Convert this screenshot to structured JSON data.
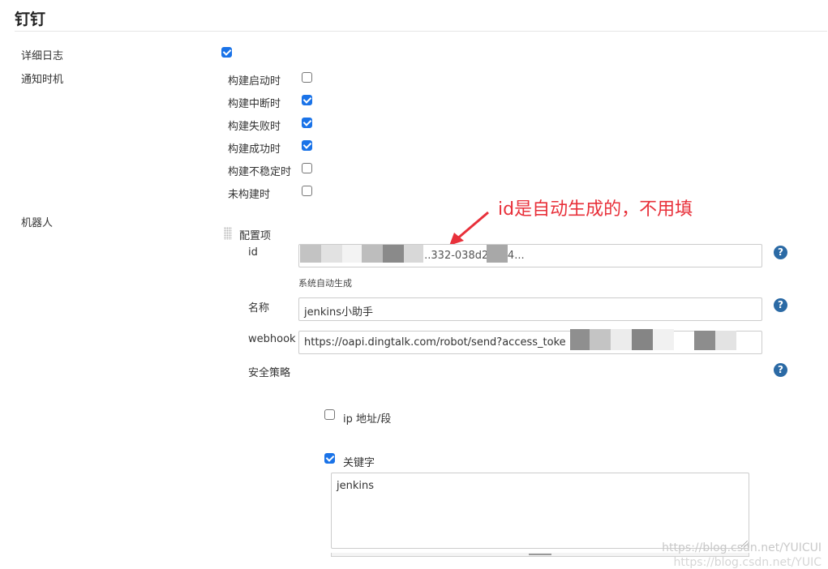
{
  "section": {
    "title": "钉钉"
  },
  "fields": {
    "verbose_log": {
      "label": "详细日志",
      "checked": true
    },
    "notify_timing": {
      "label": "通知时机",
      "options": [
        {
          "label": "构建启动时",
          "checked": false
        },
        {
          "label": "构建中断时",
          "checked": true
        },
        {
          "label": "构建失败时",
          "checked": true
        },
        {
          "label": "构建成功时",
          "checked": true
        },
        {
          "label": "构建不稳定时",
          "checked": false
        },
        {
          "label": "未构建时",
          "checked": false
        }
      ]
    },
    "robot": {
      "label": "机器人",
      "config_label": "配置项",
      "id": {
        "label": "id",
        "value": "...332-038d243c4...",
        "hint": "系统自动生成"
      },
      "name": {
        "label": "名称",
        "value": "jenkins小助手"
      },
      "webhook": {
        "label": "webhook",
        "value": "https://oapi.dingtalk.com/robot/send?access_toke"
      },
      "security": {
        "label": "安全策略",
        "ip_option": {
          "label": "ip 地址/段",
          "checked": false
        },
        "keyword_option": {
          "label": "关键字",
          "checked": true
        },
        "keyword_value": "jenkins"
      }
    }
  },
  "help_icon": "?",
  "annotation": {
    "text": "id是自动生成的，不用填",
    "color": "#e8303a"
  },
  "watermark": {
    "line1": "https://blog.csdn.net/YUICUI",
    "line2": "https://blog.csdn.net/YUIC"
  },
  "colors": {
    "checkbox_checked": "#1a73e8",
    "help_icon": "#2b6aa5"
  }
}
